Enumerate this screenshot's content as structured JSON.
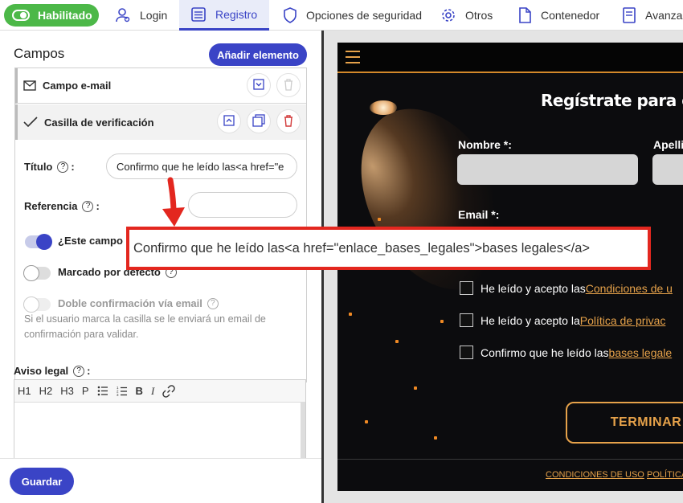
{
  "topbar": {
    "enabled_label": "Habilitado",
    "tabs": [
      {
        "label": "Login",
        "icon": "user-icon"
      },
      {
        "label": "Registro",
        "icon": "form-list-icon"
      },
      {
        "label": "Opciones de seguridad",
        "icon": "shield-icon"
      },
      {
        "label": "Otros",
        "icon": "gear-icon"
      },
      {
        "label": "Contenedor",
        "icon": "document-icon"
      },
      {
        "label": "Avanza",
        "icon": "page-edit-icon"
      }
    ]
  },
  "left": {
    "title": "Campos",
    "add_button": "Añadir elemento",
    "fields": [
      {
        "label": "Campo e-mail",
        "icon": "envelope-icon"
      },
      {
        "label": "Casilla de verificación",
        "icon": "checkmark-icon"
      }
    ],
    "form": {
      "titulo_label": "Título",
      "titulo_suffix": ":",
      "titulo_value": "Confirmo que he leído las<a href=\"e",
      "referencia_label": "Referencia",
      "referencia_suffix": ":",
      "referencia_value": "",
      "obligatorio_label": "¿Este campo e",
      "marcado_label": "Marcado por defecto",
      "doble_label": "Doble confirmación vía email",
      "hint": "Si el usuario marca la casilla se le enviará un email de confirmación para validar."
    },
    "aviso_label": "Aviso legal",
    "aviso_suffix": ":",
    "editor_tools": [
      "H1",
      "H2",
      "H3",
      "P"
    ],
    "save_button": "Guardar"
  },
  "preview": {
    "title": "Regístrate para girar",
    "nombre_label": "Nombre *:",
    "apellido_label": "Apelli",
    "email_label": "Email *:",
    "checks": [
      {
        "text": "He leído y acepto las ",
        "link": "Condiciones de u"
      },
      {
        "text": "He leído y acepto la ",
        "link": "Política de privac"
      },
      {
        "text": "Confirmo que he leído las",
        "link": "bases legale"
      }
    ],
    "submit": "TERMINAR",
    "footer_links": [
      "CONDICIONES DE USO",
      "POLÍTICA"
    ]
  },
  "callout": {
    "text": "Confirmo que he leído las<a href=\"enlace_bases_legales\">bases legales</a>"
  },
  "colors": {
    "accent": "#3a44c6",
    "enabled": "#4cb848",
    "preview_accent": "#e6a24a",
    "annotation": "#e3271f"
  }
}
